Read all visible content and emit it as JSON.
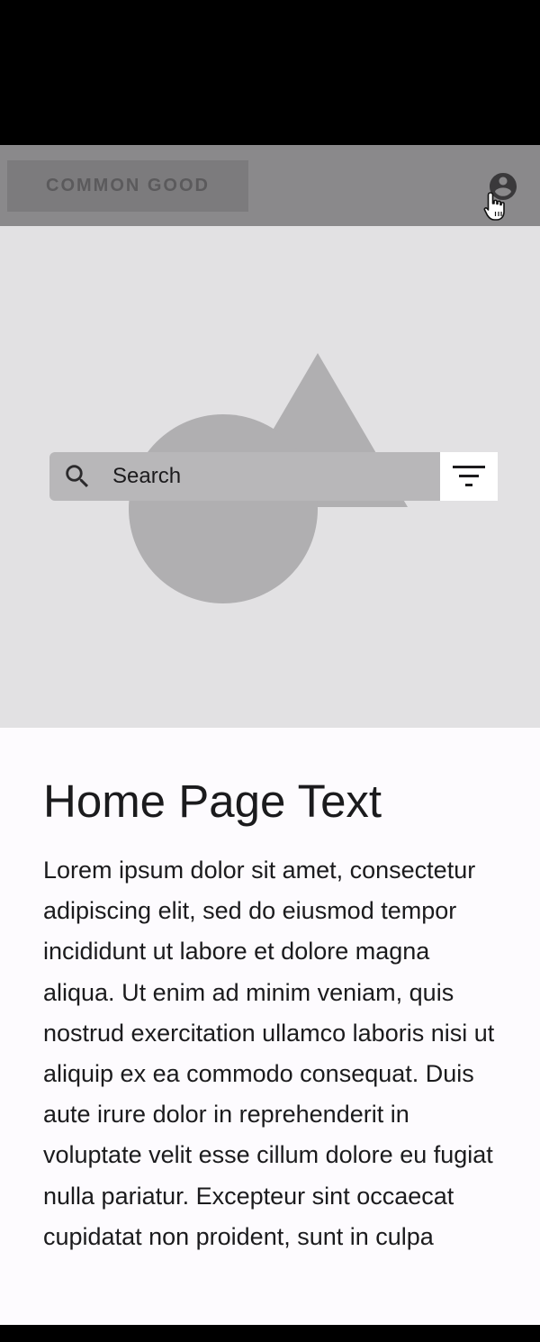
{
  "header": {
    "logo_text": "COMMON GOOD",
    "account_icon": "account-circle-icon"
  },
  "hero": {
    "search": {
      "label": "Search",
      "icon": "search-icon"
    },
    "filter_icon": "filter-icon"
  },
  "content": {
    "title": "Home Page Text",
    "body": "Lorem ipsum dolor sit amet, consectetur adipiscing elit, sed do eiusmod tempor incididunt ut labore et dolore magna aliqua. Ut enim ad minim veniam, quis nostrud exercitation ullamco laboris nisi ut aliquip ex ea commodo consequat. Duis aute irure dolor in reprehenderit in voluptate velit esse cillum dolore eu fugiat nulla pariatur. Excepteur sint occaecat cupidatat non proident, sunt in culpa"
  },
  "colors": {
    "app_bar": "#8a898b",
    "hero_background": "#e2e1e3",
    "placeholder_shapes": "#b0afb1",
    "search_bar": "#b8b7b9",
    "content_background": "#fdfbfe"
  }
}
